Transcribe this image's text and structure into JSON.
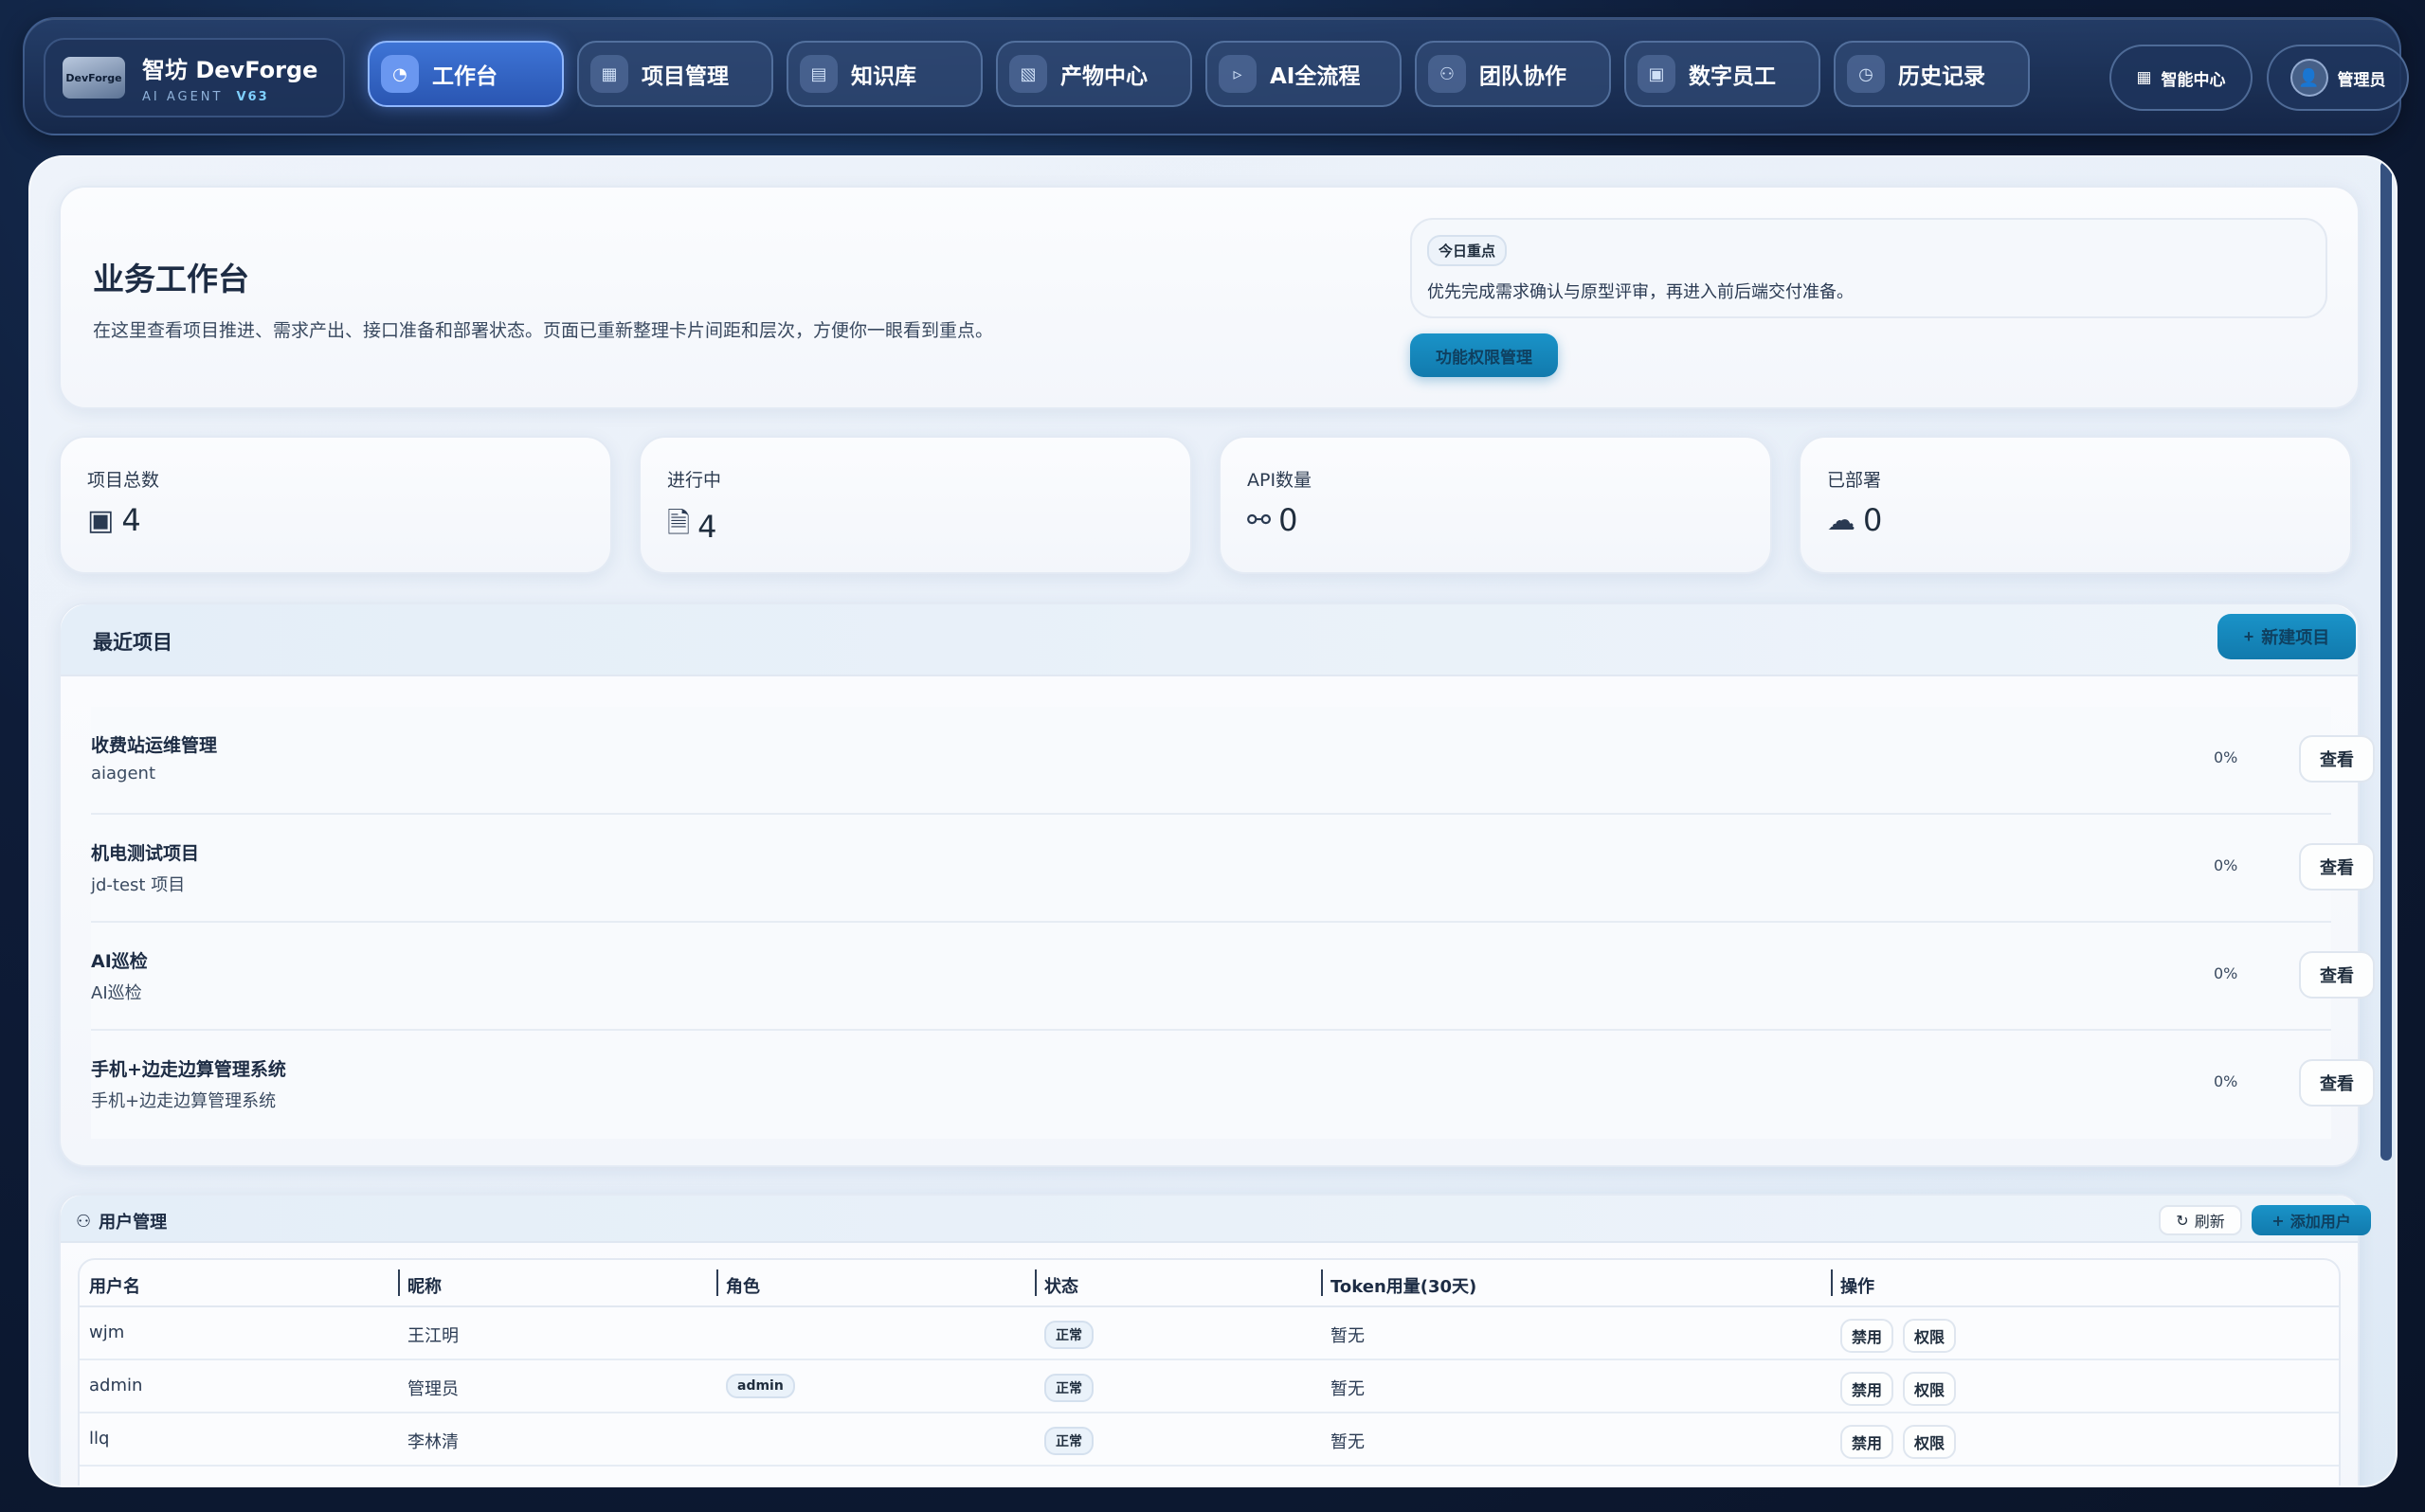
{
  "brand": {
    "logo_text": "DevForge",
    "name": "智坊 DevForge",
    "subtitle": "AI AGENT",
    "version": "V63"
  },
  "nav": {
    "items": [
      {
        "label": "工作台",
        "icon": "dashboard-icon",
        "glyph": "◔",
        "active": true
      },
      {
        "label": "项目管理",
        "icon": "kanban-icon",
        "glyph": "▦",
        "active": false
      },
      {
        "label": "知识库",
        "icon": "book-icon",
        "glyph": "▤",
        "active": false
      },
      {
        "label": "产物中心",
        "icon": "file-icon",
        "glyph": "▧",
        "active": false
      },
      {
        "label": "AI全流程",
        "icon": "terminal-icon",
        "glyph": "▹",
        "active": false
      },
      {
        "label": "团队协作",
        "icon": "team-icon",
        "glyph": "⚇",
        "active": false
      },
      {
        "label": "数字员工",
        "icon": "robot-icon",
        "glyph": "▣",
        "active": false
      },
      {
        "label": "历史记录",
        "icon": "clock-icon",
        "glyph": "◷",
        "active": false
      }
    ],
    "smart_center_label": "智能中心",
    "admin_label": "管理员"
  },
  "hero": {
    "title": "业务工作台",
    "description": "在这里查看项目推进、需求产出、接口准备和部署状态。页面已重新整理卡片间距和层次，方便你一眼看到重点。",
    "focus_tag": "今日重点",
    "focus_text": "优先完成需求确认与原型评审，再进入前后端交付准备。",
    "permission_button": "功能权限管理"
  },
  "stats": [
    {
      "label": "项目总数",
      "value": "4",
      "icon": "kanban-icon",
      "glyph": "▣"
    },
    {
      "label": "进行中",
      "value": "4",
      "icon": "document-icon",
      "glyph": "🗎"
    },
    {
      "label": "API数量",
      "value": "0",
      "icon": "plug-icon",
      "glyph": "⚯"
    },
    {
      "label": "已部署",
      "value": "0",
      "icon": "cloud-icon",
      "glyph": "☁"
    }
  ],
  "recent": {
    "title": "最近项目",
    "new_button": "新建项目",
    "view_label": "查看",
    "projects": [
      {
        "name": "收费站运维管理",
        "desc": "aiagent",
        "progress": "0%"
      },
      {
        "name": "机电测试项目",
        "desc": "jd-test 项目",
        "progress": "0%"
      },
      {
        "name": "AI巡检",
        "desc": "AI巡检",
        "progress": "0%"
      },
      {
        "name": "手机+边走边算管理系统",
        "desc": "手机+边走边算管理系统",
        "progress": "0%"
      }
    ]
  },
  "users": {
    "title": "用户管理",
    "refresh_label": "刷新",
    "add_label": "添加用户",
    "columns": [
      "用户名",
      "昵称",
      "角色",
      "状态",
      "Token用量(30天)",
      "操作"
    ],
    "disable_label": "禁用",
    "perm_label": "权限",
    "rows": [
      {
        "username": "wjm",
        "nickname": "王江明",
        "role": "",
        "status": "正常",
        "token": "暂无"
      },
      {
        "username": "admin",
        "nickname": "管理员",
        "role": "admin",
        "status": "正常",
        "token": "暂无"
      },
      {
        "username": "llq",
        "nickname": "李林清",
        "role": "",
        "status": "正常",
        "token": "暂无"
      }
    ]
  }
}
